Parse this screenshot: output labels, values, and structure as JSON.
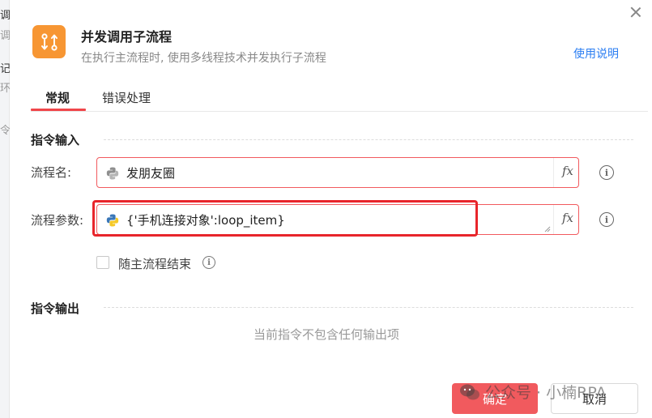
{
  "background": {
    "fragments": [
      "调",
      "调",
      "记",
      "环",
      "令"
    ]
  },
  "dialog": {
    "title": "并发调用子流程",
    "subtitle": "在执行主流程时, 使用多线程技术并发执行子流程",
    "help_link": "使用说明",
    "tabs": [
      {
        "label": "常规",
        "active": true
      },
      {
        "label": "错误处理",
        "active": false
      }
    ],
    "input_section": {
      "title": "指令输入",
      "fields": [
        {
          "label": "流程名:",
          "value": "发朋友圈",
          "icon": "python-icon",
          "fx": "fx"
        },
        {
          "label": "流程参数:",
          "value": "{'手机连接对象':loop_item}",
          "icon": "python-icon",
          "fx": "fx"
        }
      ],
      "checkbox": {
        "label": "随主流程结束",
        "checked": false
      }
    },
    "output_section": {
      "title": "指令输出",
      "empty_text": "当前指令不包含任何输出项"
    },
    "buttons": {
      "confirm": "确定",
      "cancel": "取消"
    }
  },
  "watermark": {
    "text": "公众号 · 小楠RPA"
  },
  "colors": {
    "accent": "#f15a5e",
    "link": "#2a7df2",
    "app_icon": "#f79633",
    "highlight": "#e8252b"
  }
}
